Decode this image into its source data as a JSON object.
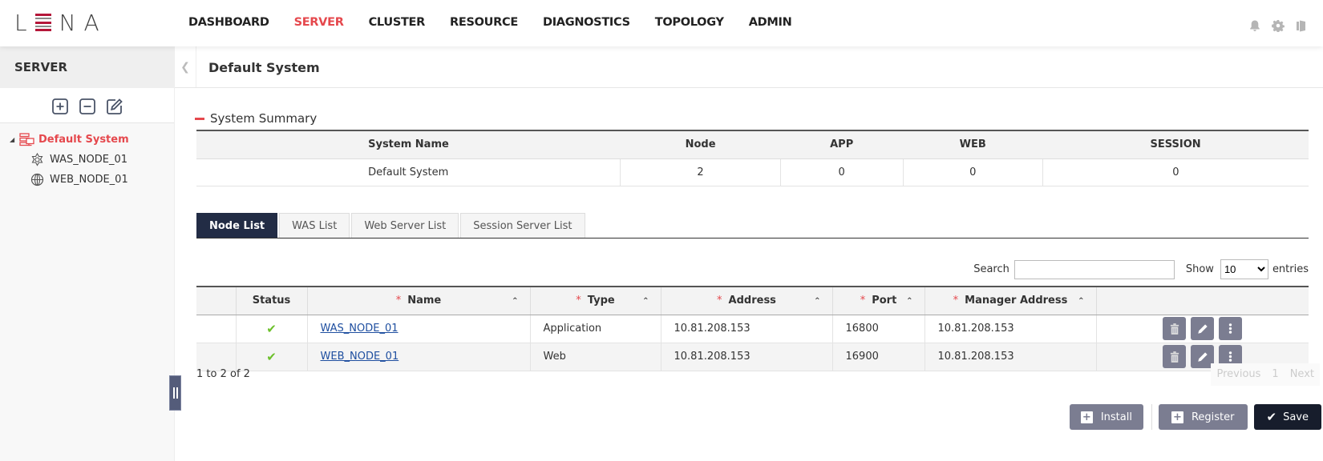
{
  "app": {
    "logo": "LENA"
  },
  "nav": {
    "items": [
      {
        "label": "DASHBOARD",
        "active": false
      },
      {
        "label": "SERVER",
        "active": true
      },
      {
        "label": "CLUSTER",
        "active": false
      },
      {
        "label": "RESOURCE",
        "active": false
      },
      {
        "label": "DIAGNOSTICS",
        "active": false
      },
      {
        "label": "TOPOLOGY",
        "active": false
      },
      {
        "label": "ADMIN",
        "active": false
      }
    ],
    "icons": [
      "bell-icon",
      "gear-icon",
      "logout-icon"
    ]
  },
  "sidebar": {
    "title": "SERVER",
    "tools": [
      "add-icon",
      "remove-icon",
      "edit-icon"
    ],
    "tree": {
      "root": {
        "label": "Default System",
        "icon": "system-icon",
        "expanded": true
      },
      "children": [
        {
          "label": "WAS_NODE_01",
          "icon": "was-node-icon"
        },
        {
          "label": "WEB_NODE_01",
          "icon": "web-node-icon"
        }
      ]
    }
  },
  "main": {
    "title": "Default System",
    "summary": {
      "section_title": "System Summary",
      "headers": [
        "System Name",
        "Node",
        "APP",
        "WEB",
        "SESSION"
      ],
      "row": [
        "Default System",
        "2",
        "0",
        "0",
        "0"
      ]
    },
    "tabs": [
      {
        "label": "Node List",
        "active": true
      },
      {
        "label": "WAS List",
        "active": false
      },
      {
        "label": "Web Server List",
        "active": false
      },
      {
        "label": "Session Server List",
        "active": false
      }
    ],
    "search": {
      "label": "Search",
      "value": "",
      "placeholder": ""
    },
    "show": {
      "label_before": "Show",
      "value": "10",
      "label_after": "entries"
    },
    "grid": {
      "headers": [
        {
          "label": "",
          "required": false,
          "sortable": false
        },
        {
          "label": "Status",
          "required": false,
          "sortable": false
        },
        {
          "label": "Name",
          "required": true,
          "sortable": true
        },
        {
          "label": "Type",
          "required": true,
          "sortable": true
        },
        {
          "label": "Address",
          "required": true,
          "sortable": true
        },
        {
          "label": "Port",
          "required": true,
          "sortable": true
        },
        {
          "label": "Manager Address",
          "required": true,
          "sortable": true
        },
        {
          "label": "",
          "required": false,
          "sortable": false
        }
      ],
      "required_mark": "*",
      "rows": [
        {
          "status": "ok",
          "name": "WAS_NODE_01",
          "type": "Application",
          "address": "10.81.208.153",
          "port": "16800",
          "manager_address": "10.81.208.153"
        },
        {
          "status": "ok",
          "name": "WEB_NODE_01",
          "type": "Web",
          "address": "10.81.208.153",
          "port": "16900",
          "manager_address": "10.81.208.153"
        }
      ]
    },
    "info": "1 to 2 of 2",
    "pager": {
      "previous": "Previous",
      "page": "1",
      "next": "Next"
    },
    "buttons": {
      "install": "Install",
      "register": "Register",
      "save": "Save"
    }
  },
  "colors": {
    "accent": "#e5484d",
    "tab_active": "#222c45",
    "button_gray": "#7b7d91",
    "button_dark": "#171d2c",
    "status_ok": "#6cc02b"
  }
}
